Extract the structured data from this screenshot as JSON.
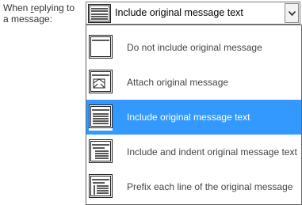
{
  "label": {
    "line1_pre": "When ",
    "line1_ul": "r",
    "line1_post": "eplying to",
    "line2": "a message:"
  },
  "combo": {
    "value": "Include original message text",
    "icon": "include-text-icon"
  },
  "options": [
    {
      "label": "Do not include original message",
      "icon": "blank-message-icon"
    },
    {
      "label": "Attach original message",
      "icon": "attachment-envelope-icon"
    },
    {
      "label": "Include original message text",
      "icon": "include-text-icon"
    },
    {
      "label": "Include and indent original message text",
      "icon": "indent-text-icon"
    },
    {
      "label": "Prefix each line of the original message",
      "icon": "prefix-lines-icon"
    }
  ],
  "selected_index": 2,
  "colors": {
    "selection": "#3399ff",
    "border": "#646464"
  }
}
